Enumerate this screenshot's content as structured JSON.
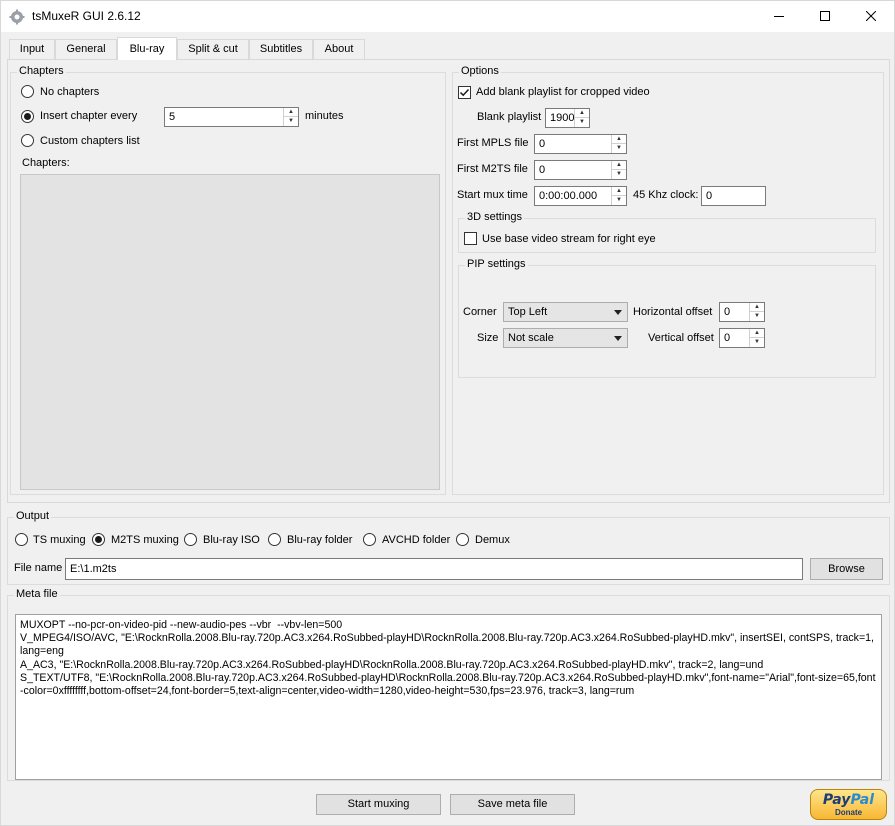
{
  "window": {
    "title": "tsMuxeR GUI 2.6.12"
  },
  "tabs": [
    "Input",
    "General",
    "Blu-ray",
    "Split & cut",
    "Subtitles",
    "About"
  ],
  "active_tab": "Blu-ray",
  "chapters": {
    "title": "Chapters",
    "no_chapters": "No chapters",
    "insert_every": "Insert chapter every",
    "insert_every_value": "5",
    "minutes": "minutes",
    "custom_list": "Custom chapters list",
    "list_label": "Chapters:",
    "selected": "insert_every"
  },
  "options": {
    "title": "Options",
    "add_blank_playlist": "Add blank playlist for cropped video",
    "add_blank_playlist_checked": true,
    "blank_playlist_label": "Blank playlist",
    "blank_playlist_value": "1900",
    "first_mpls_label": "First MPLS file",
    "first_mpls_value": "0",
    "first_m2ts_label": "First M2TS file",
    "first_m2ts_value": "0",
    "start_mux_label": "Start mux time",
    "start_mux_value": "0:00:00.000",
    "clock_label": "45 Khz clock:",
    "clock_value": "0",
    "settings_3d": {
      "title": "3D settings",
      "base_stream_right_eye": "Use base video stream for right eye",
      "checked": false
    },
    "pip": {
      "title": "PIP settings",
      "corner_label": "Corner",
      "corner_value": "Top Left",
      "size_label": "Size",
      "size_value": "Not scale",
      "h_offset_label": "Horizontal offset",
      "h_offset_value": "0",
      "v_offset_label": "Vertical offset",
      "v_offset_value": "0"
    }
  },
  "output": {
    "title": "Output",
    "modes": [
      "TS muxing",
      "M2TS muxing",
      "Blu-ray ISO",
      "Blu-ray folder",
      "AVCHD folder",
      "Demux"
    ],
    "selected": "M2TS muxing",
    "file_name_label": "File name",
    "file_name_value": "E:\\1.m2ts",
    "browse": "Browse"
  },
  "meta": {
    "title": "Meta file",
    "text": "MUXOPT --no-pcr-on-video-pid --new-audio-pes --vbr  --vbv-len=500\nV_MPEG4/ISO/AVC, \"E:\\RocknRolla.2008.Blu-ray.720p.AC3.x264.RoSubbed-playHD\\RocknRolla.2008.Blu-ray.720p.AC3.x264.RoSubbed-playHD.mkv\", insertSEI, contSPS, track=1, lang=eng\nA_AC3, \"E:\\RocknRolla.2008.Blu-ray.720p.AC3.x264.RoSubbed-playHD\\RocknRolla.2008.Blu-ray.720p.AC3.x264.RoSubbed-playHD.mkv\", track=2, lang=und\nS_TEXT/UTF8, \"E:\\RocknRolla.2008.Blu-ray.720p.AC3.x264.RoSubbed-playHD\\RocknRolla.2008.Blu-ray.720p.AC3.x264.RoSubbed-playHD.mkv\",font-name=\"Arial\",font-size=65,font-color=0xffffffff,bottom-offset=24,font-border=5,text-align=center,video-width=1280,video-height=530,fps=23.976, track=3, lang=rum"
  },
  "buttons": {
    "start_muxing": "Start muxing",
    "save_meta": "Save meta file"
  },
  "paypal": {
    "brand_1": "Pay",
    "brand_2": "Pal",
    "donate": "Donate"
  },
  "colors": {
    "window_bg": "#f0f0f0",
    "tab_active_bg": "#ffffff",
    "paypal_gold": "#f7b733",
    "paypal_blue": "#1c3d7a"
  }
}
